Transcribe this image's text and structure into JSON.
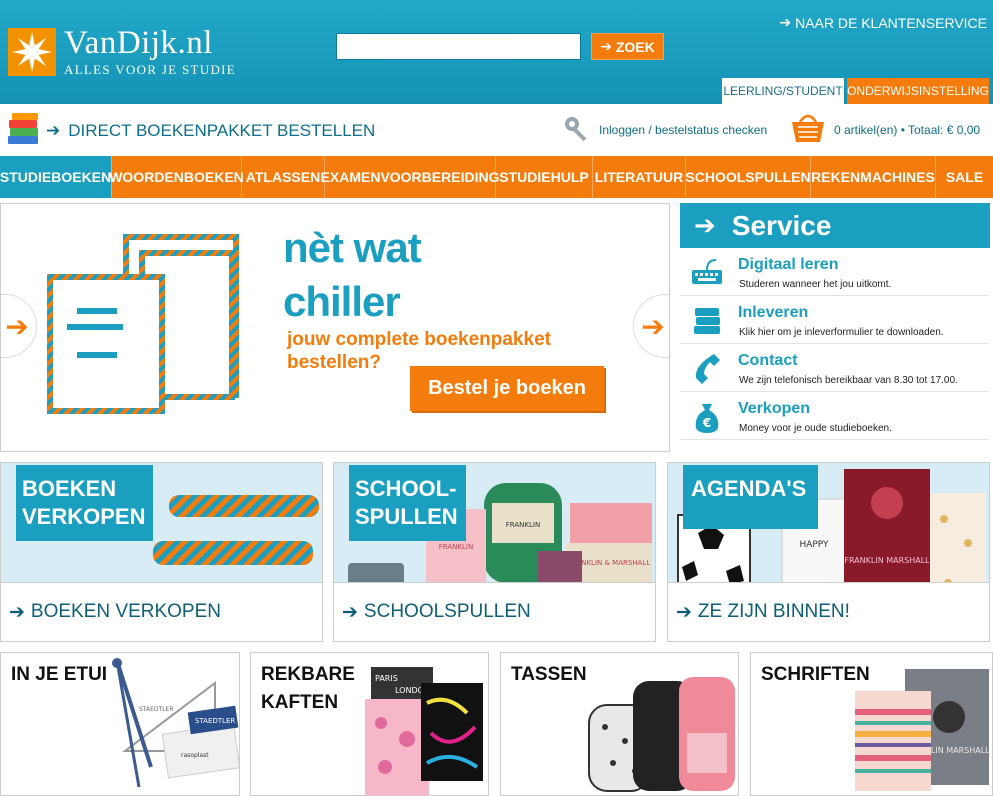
{
  "header": {
    "logo_name": "VanDijk.nl",
    "logo_tagline": "ALLES VOOR JE STUDIE",
    "search_placeholder": "",
    "search_button": "ZOEK",
    "service_link": "NAAR DE KLANTENSERVICE",
    "tabs": [
      {
        "label": "LEERLING/STUDENT",
        "active": true
      },
      {
        "label": "ONDERWIJSINSTELLING",
        "active": false
      }
    ],
    "brand_color": "#1a9fc0",
    "accent_color": "#f47c0c"
  },
  "subbar": {
    "direct_label": "DIRECT BOEKENPAKKET BESTELLEN",
    "login_label": "Inloggen / bestelstatus checken",
    "cart_label": "0 artikel(en) • Totaal: € 0,00"
  },
  "nav": {
    "items": [
      {
        "label": "STUDIEBOEKEN",
        "active": true
      },
      {
        "label": "WOORDENBOEKEN",
        "active": false
      },
      {
        "label": "ATLASSEN",
        "active": false
      },
      {
        "label": "EXAMENVOORBEREIDING",
        "active": false
      },
      {
        "label": "STUDIEHULP",
        "active": false
      },
      {
        "label": "LITERATUUR",
        "active": false
      },
      {
        "label": "SCHOOLSPULLEN",
        "active": false
      },
      {
        "label": "REKENMACHINES",
        "active": false
      },
      {
        "label": "SALE",
        "active": false
      }
    ]
  },
  "hero": {
    "title_line1": "nèt wat",
    "title_line2": "chiller",
    "subtitle_line1": "jouw complete boekenpakket",
    "subtitle_line2": "bestellen?",
    "cta": "Bestel je boeken"
  },
  "service": {
    "title": "Service",
    "items": [
      {
        "title": "Digitaal leren",
        "desc": "Studeren wanneer het jou uitkomt.",
        "icon": "keyboard-icon"
      },
      {
        "title": "Inleveren",
        "desc": "Klik hier om je inleverformulier te downloaden.",
        "icon": "books-stack-icon"
      },
      {
        "title": "Contact",
        "desc": "We zijn telefonisch bereikbaar van 8.30 tot 17.00.",
        "icon": "phone-icon"
      },
      {
        "title": "Verkopen",
        "desc": "Money voor je oude studieboeken.",
        "icon": "money-bag-icon"
      }
    ]
  },
  "promos": [
    {
      "tag_line1": "BOEKEN",
      "tag_line2": "VERKOPEN",
      "link": "BOEKEN VERKOPEN"
    },
    {
      "tag_line1": "SCHOOL-",
      "tag_line2": "SPULLEN",
      "link": "SCHOOLSPULLEN"
    },
    {
      "tag_line1": "AGENDA'S",
      "tag_line2": "",
      "link": "ZE ZIJN BINNEN!"
    }
  ],
  "tiles": [
    {
      "line1": "IN JE ETUI",
      "line2": ""
    },
    {
      "line1": "REKBARE",
      "line2": "KAFTEN"
    },
    {
      "line1": "TASSEN",
      "line2": ""
    },
    {
      "line1": "SCHRIFTEN",
      "line2": ""
    }
  ],
  "decor": {
    "pencil_brand": "STAEDTLER",
    "pencil_product": "rasoplast",
    "ruler_brand": "STAEDTLER",
    "backpack_brand": "FRANKLIN",
    "backpack_brand_full": "FRANKLIN & MARSHALL",
    "notebook_text": "FRANKLIN MARSHALL",
    "kaft_city_1": "PARIS",
    "kaft_city_2": "LONDON",
    "agenda_brand": "voetbal",
    "agenda_text_2": "HAPPY"
  }
}
